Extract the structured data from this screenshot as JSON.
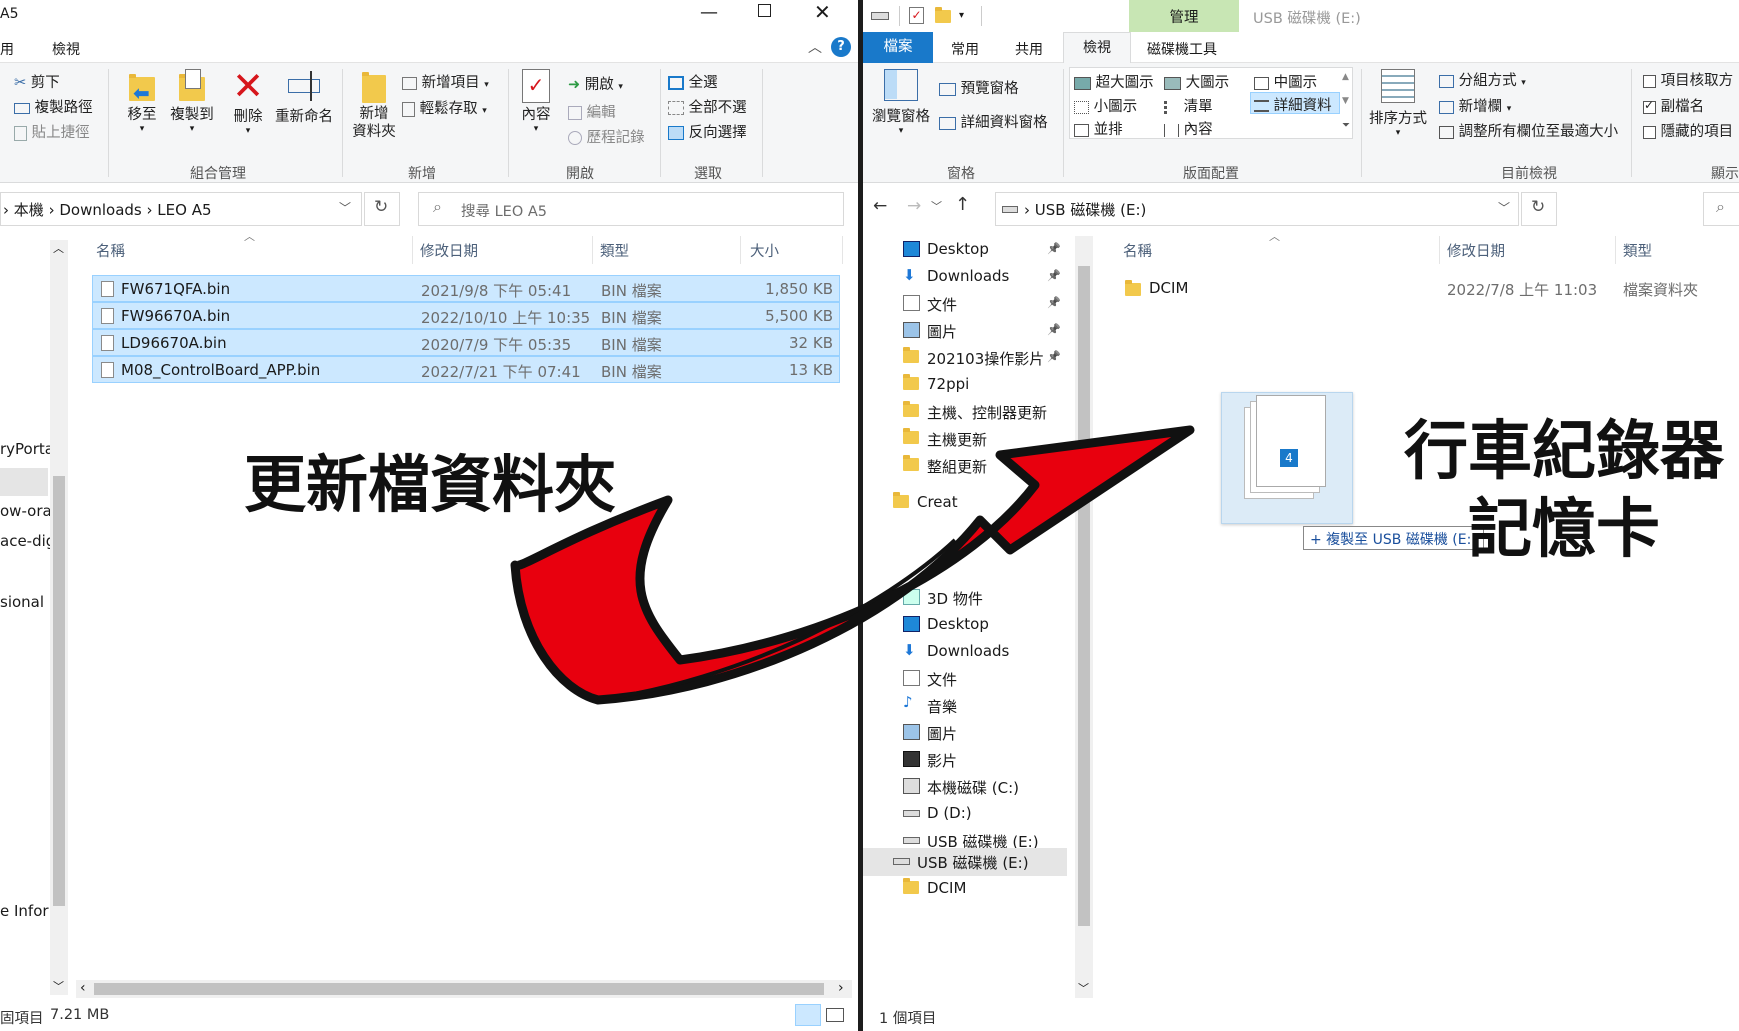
{
  "left": {
    "title": "A5",
    "menu": {
      "tab_view_partial": "用",
      "tab_view": "檢視"
    },
    "clipboard": {
      "cut": "剪下",
      "copy_path": "複製路徑",
      "paste_shortcut": "貼上捷徑"
    },
    "organize": {
      "move_to": "移至",
      "copy_to": "複製到",
      "delete": "刪除",
      "rename": "重新命名",
      "label": "組合管理"
    },
    "new": {
      "new_folder": "新增\n資料夾",
      "new_folder_l1": "新增",
      "new_folder_l2": "資料夾",
      "new_item": "新增項目",
      "easy_access": "輕鬆存取",
      "label": "新增"
    },
    "open": {
      "properties": "內容",
      "open": "開啟",
      "edit": "編輯",
      "history": "歷程記錄",
      "label": "開啟"
    },
    "select": {
      "select_all": "全選",
      "select_none": "全部不選",
      "invert": "反向選擇",
      "label": "選取"
    },
    "breadcrumb": [
      "本機",
      "Downloads",
      "LEO A5"
    ],
    "search_placeholder": "搜尋 LEO A5",
    "columns": {
      "name": "名稱",
      "modified": "修改日期",
      "type": "類型",
      "size": "大小"
    },
    "files": [
      {
        "name": "FW671QFA.bin",
        "modified": "2021/9/8 下午 05:41",
        "type": "BIN 檔案",
        "size": "1,850 KB"
      },
      {
        "name": "FW96670A.bin",
        "modified": "2022/10/10 上午 10:35",
        "type": "BIN 檔案",
        "size": "5,500 KB"
      },
      {
        "name": "LD96670A.bin",
        "modified": "2020/7/9 下午 05:35",
        "type": "BIN 檔案",
        "size": "32 KB"
      },
      {
        "name": "M08_ControlBoard_APP.bin",
        "modified": "2022/7/21 下午 07:41",
        "type": "BIN 檔案",
        "size": "13 KB"
      }
    ],
    "nav_partial": [
      "ryPorta",
      "ow-orar",
      "ace-dig",
      "sional F",
      "e Infor"
    ],
    "status": {
      "items": "固項目",
      "size": "7.21 MB"
    }
  },
  "right": {
    "title_manage": "管理",
    "title": "USB 磁碟機 (E:)",
    "tabs": [
      "檔案",
      "常用",
      "共用",
      "檢視",
      "磁碟機工具"
    ],
    "panes": {
      "nav_pane": "瀏覽窗格",
      "preview": "預覽窗格",
      "details_pane": "詳細資料窗格",
      "label": "窗格"
    },
    "layout": {
      "extra_large": "超大圖示",
      "large": "大圖示",
      "medium": "中圖示",
      "small": "小圖示",
      "list": "清單",
      "details": "詳細資料",
      "tiles": "並排",
      "content": "內容",
      "label": "版面配置"
    },
    "current_view": {
      "sort": "排序方式",
      "group": "分組方式",
      "add_col": "新增欄",
      "fit_cols": "調整所有欄位至最適大小",
      "label": "目前檢視"
    },
    "show_hide": {
      "item_checkboxes": "項目核取方",
      "extensions": "副檔名",
      "hidden": "隱藏的項目",
      "label": "顯示"
    },
    "address": "USB 磁碟機 (E:)",
    "nav": [
      {
        "label": "Desktop",
        "icon": "desktop-icon",
        "pinned": true
      },
      {
        "label": "Downloads",
        "icon": "download-icon",
        "pinned": true
      },
      {
        "label": "文件",
        "icon": "document-icon",
        "pinned": true
      },
      {
        "label": "圖片",
        "icon": "picture-icon",
        "pinned": true
      },
      {
        "label": "202103操作影片",
        "icon": "folder-icon",
        "pinned": true
      },
      {
        "label": "72ppi",
        "icon": "folder-icon",
        "pinned": false
      },
      {
        "label": "主機、控制器更新",
        "icon": "folder-icon",
        "pinned": false
      },
      {
        "label": "主機更新",
        "icon": "folder-icon",
        "pinned": false
      },
      {
        "label": "整組更新",
        "icon": "folder-icon",
        "pinned": false
      },
      {
        "label": "Creat",
        "icon": "creative-cloud-icon",
        "pinned": false
      }
    ],
    "nav2": [
      {
        "label": "3D 物件",
        "icon": "3d-icon"
      },
      {
        "label": "Desktop",
        "icon": "desktop-icon"
      },
      {
        "label": "Downloads",
        "icon": "download-icon"
      },
      {
        "label": "文件",
        "icon": "document-icon"
      },
      {
        "label": "音樂",
        "icon": "music-icon"
      },
      {
        "label": "圖片",
        "icon": "picture-icon"
      },
      {
        "label": "影片",
        "icon": "video-icon"
      },
      {
        "label": "本機磁碟 (C:)",
        "icon": "drive-c-icon"
      },
      {
        "label": "D (D:)",
        "icon": "drive-icon"
      },
      {
        "label": "USB 磁碟機 (E:)",
        "icon": "usb-drive-icon"
      }
    ],
    "nav3": [
      {
        "label": "USB 磁碟機 (E:)",
        "icon": "usb-drive-icon"
      },
      {
        "label": "DCIM",
        "icon": "folder-icon"
      }
    ],
    "columns": {
      "name": "名稱",
      "modified": "修改日期",
      "type": "類型"
    },
    "files": [
      {
        "name": "DCIM",
        "modified": "2022/7/8 上午 11:03",
        "type": "檔案資料夾"
      }
    ],
    "drag": {
      "count": "4",
      "tooltip": "+ 複製至 USB 磁碟機 (E:)"
    },
    "status": "1 個項目"
  },
  "annotations": {
    "source": "更新檔資料夾",
    "target_line1": "行車紀錄器",
    "target_line2": "記憶卡"
  },
  "colors": {
    "accent": "#1979ca",
    "selection": "#cce8ff",
    "arrow": "#e8000e",
    "manage_tab": "#c8e6b4"
  }
}
